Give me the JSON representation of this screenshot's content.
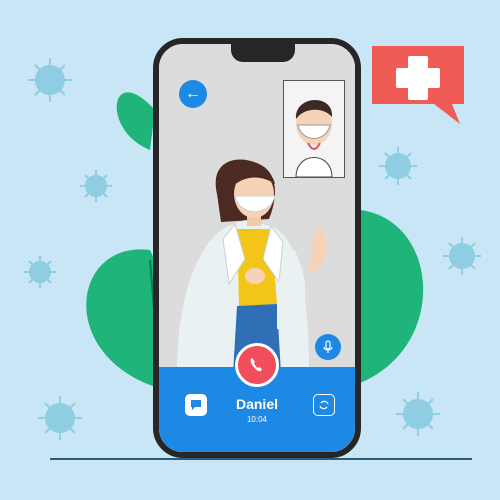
{
  "call": {
    "caller_name": "Daniel",
    "duration": "10:04"
  },
  "colors": {
    "background": "#c8e6f5",
    "accent": "#1e88e5",
    "end_call": "#f04e5a",
    "leaf": "#1fb57a",
    "virus": "#8fcde2",
    "bubble": "#f15b55"
  },
  "icons": {
    "back": "arrow-left-icon",
    "mic": "microphone-icon",
    "end_call": "phone-hangup-icon",
    "chat": "chat-icon",
    "switch_camera": "switch-camera-icon",
    "medical": "medical-cross-icon"
  }
}
